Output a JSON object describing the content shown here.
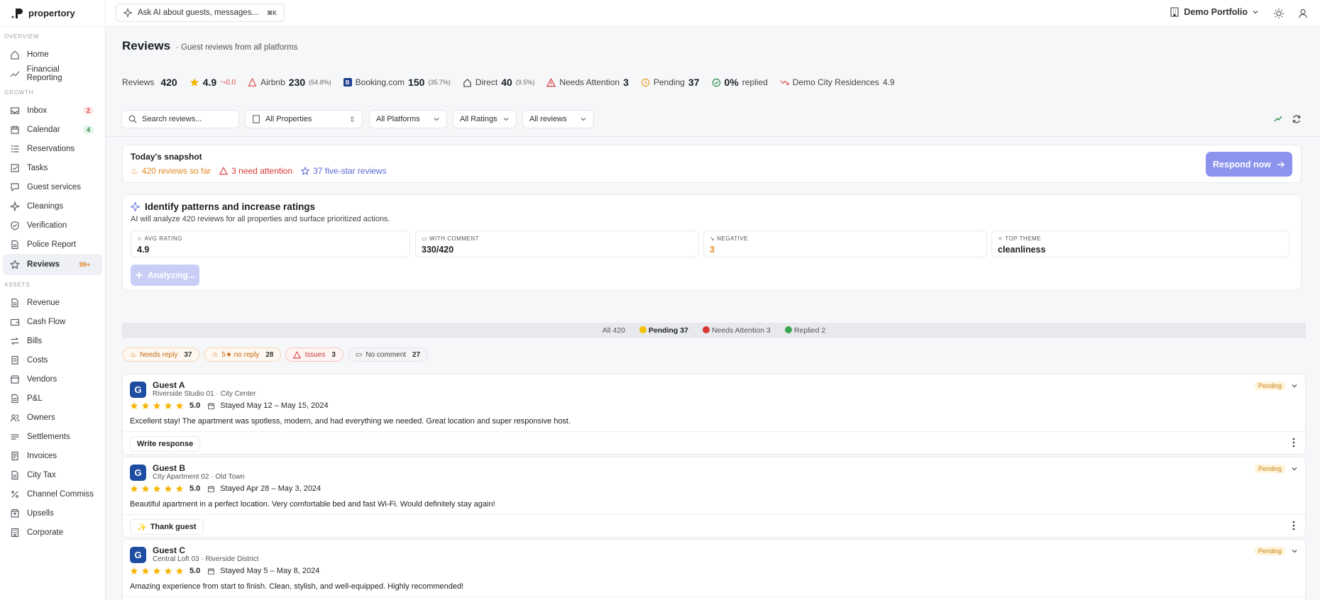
{
  "app": {
    "name": "propertory"
  },
  "topbar": {
    "ask_placeholder": "Ask AI about guests, messages...",
    "ask_shortcut": "⌘K",
    "portfolio": "Demo Portfolio"
  },
  "sidebar": {
    "sections": [
      {
        "label": "OVERVIEW",
        "items": [
          {
            "label": "Home",
            "icon": "home-icon"
          },
          {
            "label": "Financial Reporting",
            "icon": "trend-icon"
          }
        ]
      },
      {
        "label": "GROWTH",
        "items": [
          {
            "label": "Inbox",
            "icon": "inbox-icon",
            "badge": "2"
          },
          {
            "label": "Calendar",
            "icon": "calendar-icon",
            "badge": "4"
          },
          {
            "label": "Reservations",
            "icon": "list-icon"
          },
          {
            "label": "Tasks",
            "icon": "check-square-icon"
          },
          {
            "label": "Guest services",
            "icon": "chat-icon"
          },
          {
            "label": "Cleanings",
            "icon": "sparkle-icon"
          },
          {
            "label": "Verification",
            "icon": "shield-check-icon"
          },
          {
            "label": "Police Report",
            "icon": "document-icon"
          },
          {
            "label": "Reviews",
            "icon": "star-icon",
            "badge": "99+"
          }
        ]
      },
      {
        "label": "ASSETS",
        "items": [
          {
            "label": "Revenue",
            "icon": "document-icon"
          },
          {
            "label": "Cash Flow",
            "icon": "wallet-icon"
          },
          {
            "label": "Bills",
            "icon": "arrows-icon"
          },
          {
            "label": "Costs",
            "icon": "receipt-icon"
          },
          {
            "label": "Vendors",
            "icon": "vendor-icon"
          },
          {
            "label": "P&L",
            "icon": "document-icon"
          },
          {
            "label": "Owners",
            "icon": "users-icon"
          },
          {
            "label": "Settlements",
            "icon": "settlement-icon"
          },
          {
            "label": "Invoices",
            "icon": "invoice-icon"
          },
          {
            "label": "City Tax",
            "icon": "document-icon"
          },
          {
            "label": "Channel Commiss",
            "icon": "percent-icon"
          },
          {
            "label": "Upsells",
            "icon": "upsell-icon"
          },
          {
            "label": "Corporate",
            "icon": "building-icon"
          }
        ]
      }
    ]
  },
  "page": {
    "title": "Reviews",
    "subtitle": "Guest reviews from all platforms"
  },
  "stats": {
    "reviews_label": "Reviews",
    "reviews_value": "420",
    "rating": "4.9",
    "rating_delta": "0.0",
    "airbnb_label": "Airbnb",
    "airbnb_value": "230",
    "airbnb_pct": "(54.8%)",
    "booking_label": "Booking.com",
    "booking_value": "150",
    "booking_pct": "(35.7%)",
    "direct_label": "Direct",
    "direct_value": "40",
    "direct_pct": "(9.5%)",
    "attention_label": "Needs Attention",
    "attention_value": "3",
    "pending_label": "Pending",
    "pending_value": "37",
    "replied_value": "0%",
    "replied_label": "replied",
    "property_label": "Demo City Residences",
    "property_value": "4.9"
  },
  "filters": {
    "search_placeholder": "Search reviews...",
    "properties": "All Properties",
    "platforms": "All Platforms",
    "ratings": "All Ratings",
    "reviews": "All reviews"
  },
  "snapshot": {
    "title": "Today's snapshot",
    "so_far": "420 reviews so far",
    "attention": "3 need attention",
    "five_star": "37 five-star reviews",
    "respond": "Respond now"
  },
  "ai": {
    "title": "Identify patterns and increase ratings",
    "subtitle": "AI will analyze 420 reviews for all properties and surface prioritized actions.",
    "metrics": [
      {
        "label": "AVG RATING",
        "value": "4.9"
      },
      {
        "label": "WITH COMMENT",
        "value": "330/420"
      },
      {
        "label": "NEGATIVE",
        "value": "3"
      },
      {
        "label": "TOP THEME",
        "value": "cleanliness"
      }
    ],
    "button": "Analyzing..."
  },
  "status_tabs": {
    "all_label": "All",
    "all_count": "420",
    "pending_label": "Pending",
    "pending_count": "37",
    "attention_label": "Needs Attention",
    "attention_count": "3",
    "replied_label": "Replied",
    "replied_count": "2"
  },
  "chips": [
    {
      "label": "Needs reply",
      "count": "37"
    },
    {
      "label": "5★ no reply",
      "count": "28"
    },
    {
      "label": "Issues",
      "count": "3"
    },
    {
      "label": "No comment",
      "count": "27"
    }
  ],
  "reviews": [
    {
      "initial": "G",
      "name": "Guest A",
      "property": "Riverside Studio 01 · City Center",
      "rating": "5.0",
      "stay": "Stayed May 12 – May 15, 2024",
      "text": "Excellent stay! The apartment was spotless, modern, and had everything we needed. Great location and super responsive host.",
      "status": "Pending",
      "action": "Write response"
    },
    {
      "initial": "G",
      "name": "Guest B",
      "property": "City Apartment 02 · Old Town",
      "rating": "5.0",
      "stay": "Stayed Apr 28 – May 3, 2024",
      "text": "Beautiful apartment in a perfect location. Very comfortable bed and fast Wi-Fi. Would definitely stay again!",
      "status": "Pending",
      "action": "Thank guest"
    },
    {
      "initial": "G",
      "name": "Guest C",
      "property": "Central Loft 03 · Riverside District",
      "rating": "5.0",
      "stay": "Stayed May 5 – May 8, 2024",
      "text": "Amazing experience from start to finish. Clean, stylish, and well-equipped. Highly recommended!",
      "status": "Pending",
      "action": ""
    }
  ],
  "colors": {
    "accent": "#8b93ec",
    "star": "#f4b400",
    "pending": "#c88418",
    "danger": "#d93636",
    "success": "#2d8a4a"
  }
}
